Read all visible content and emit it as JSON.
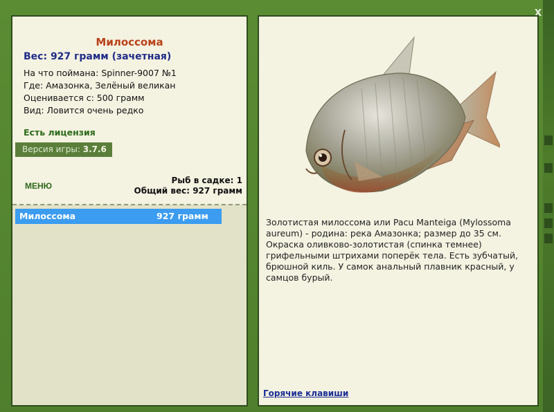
{
  "close_label": "x",
  "fish": {
    "title": "Милоссома",
    "weight_line": "Вес: 927 грамм (зачетная)",
    "info": [
      "На что поймана: Spinner-9007 №1",
      "Где: Амазонка, Зелёный великан",
      "Оценивается с: 500 грамм",
      "Вид: Ловится очень редко"
    ],
    "license": "Есть лицензия",
    "version_label": "Версия игры:",
    "version_value": "3.7.6",
    "description": "Золотистая милоссома или Pacu Manteiga (Mylossoma aureum) - родина: река Амазонка; размер до 35 см. Окраска оливково-золотистая (спинка темнее) грифельными штрихами поперёк тела. Есть зубчатый, брюшной киль. У самок анальный плавник красный, у самцов бурый."
  },
  "menu_label": "МЕНЮ",
  "cage": {
    "count_line": "Рыб в садке: 1",
    "total_line": "Общий вес: 927 грамм"
  },
  "fish_list": [
    {
      "name": "Милоссома",
      "weight": "927 грамм"
    }
  ],
  "hotkeys_label": "Горячие клавиши",
  "colors": {
    "title": "#b8421a",
    "weight": "#1f2c88",
    "selection": "#3b9cf0",
    "license": "#2c6b1a",
    "frame": "#4f7f2c"
  }
}
